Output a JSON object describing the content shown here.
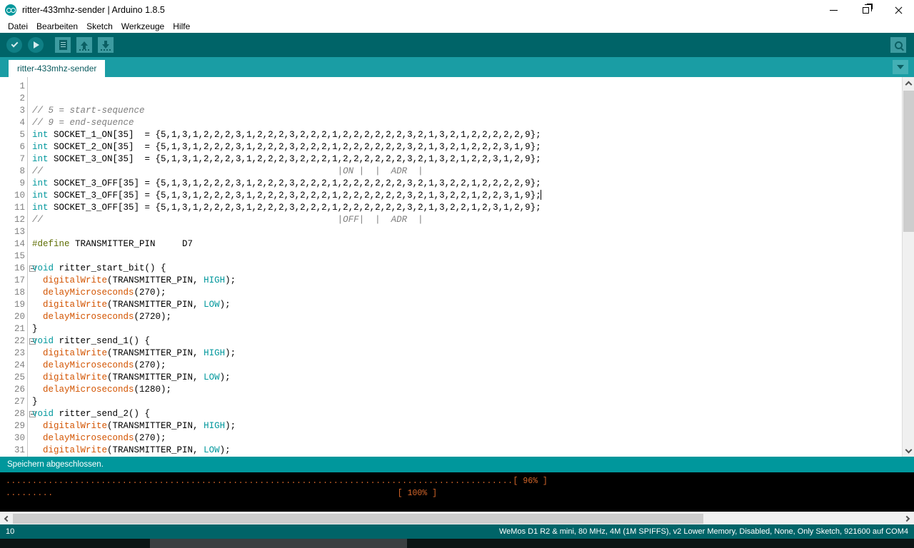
{
  "window": {
    "title": "ritter-433mhz-sender | Arduino 1.8.5",
    "app_icon": "arduino-infinity-icon",
    "controls": {
      "minimize": "minimize-icon",
      "maximize": "restore-icon",
      "close": "close-icon"
    }
  },
  "menu": {
    "items": [
      {
        "label": "Datei"
      },
      {
        "label": "Bearbeiten"
      },
      {
        "label": "Sketch"
      },
      {
        "label": "Werkzeuge"
      },
      {
        "label": "Hilfe"
      }
    ]
  },
  "toolbar": {
    "buttons": [
      {
        "name": "verify-button",
        "icon": "checkmark-icon"
      },
      {
        "name": "upload-button",
        "icon": "arrow-right-icon"
      },
      {
        "name": "new-button",
        "icon": "document-icon"
      },
      {
        "name": "open-button",
        "icon": "arrow-up-icon"
      },
      {
        "name": "save-button",
        "icon": "arrow-down-icon"
      }
    ],
    "serial_monitor": {
      "name": "serial-monitor-button",
      "icon": "magnifier-icon"
    }
  },
  "tabs": {
    "active": "ritter-433mhz-sender",
    "menu_icon": "chevron-down-icon"
  },
  "editor": {
    "cursor_line": 10,
    "lines": [
      {
        "n": 1,
        "fold": false,
        "tokens": []
      },
      {
        "n": 2,
        "fold": false,
        "tokens": []
      },
      {
        "n": 3,
        "fold": false,
        "tokens": [
          {
            "c": "c",
            "t": "// 5 = start-sequence"
          }
        ]
      },
      {
        "n": 4,
        "fold": false,
        "tokens": [
          {
            "c": "c",
            "t": "// 9 = end-sequence"
          }
        ]
      },
      {
        "n": 5,
        "fold": false,
        "tokens": [
          {
            "c": "k",
            "t": "int"
          },
          {
            "c": "t",
            "t": " SOCKET_1_ON[35]  = {5,1,3,1,2,2,2,3,1,2,2,2,3,2,2,2,1,2,2,2,2,2,2,3,2,1,3,2,1,2,2,2,2,2,9};"
          }
        ]
      },
      {
        "n": 6,
        "fold": false,
        "tokens": [
          {
            "c": "k",
            "t": "int"
          },
          {
            "c": "t",
            "t": " SOCKET_2_ON[35]  = {5,1,3,1,2,2,2,3,1,2,2,2,3,2,2,2,1,2,2,2,2,2,2,3,2,1,3,2,1,2,2,2,3,1,9};"
          }
        ]
      },
      {
        "n": 7,
        "fold": false,
        "tokens": [
          {
            "c": "k",
            "t": "int"
          },
          {
            "c": "t",
            "t": " SOCKET_3_ON[35]  = {5,1,3,1,2,2,2,3,1,2,2,2,3,2,2,2,1,2,2,2,2,2,2,3,2,1,3,2,1,2,2,3,1,2,9};"
          }
        ]
      },
      {
        "n": 8,
        "fold": false,
        "tokens": [
          {
            "c": "c",
            "t": "//                                                       |ON |  |  ADR  |"
          }
        ]
      },
      {
        "n": 9,
        "fold": false,
        "tokens": [
          {
            "c": "k",
            "t": "int"
          },
          {
            "c": "t",
            "t": " SOCKET_3_OFF[35] = {5,1,3,1,2,2,2,3,1,2,2,2,3,2,2,2,1,2,2,2,2,2,2,3,2,1,3,2,2,1,2,2,2,2,9};"
          }
        ]
      },
      {
        "n": 10,
        "fold": false,
        "cursor": true,
        "tokens": [
          {
            "c": "k",
            "t": "int"
          },
          {
            "c": "t",
            "t": " SOCKET_3_OFF[35] = {5,1,3,1,2,2,2,3,1,2,2,2,3,2,2,2,1,2,2,2,2,2,2,3,2,1,3,2,2,1,2,2,3,1,9};"
          }
        ]
      },
      {
        "n": 11,
        "fold": false,
        "tokens": [
          {
            "c": "k",
            "t": "int"
          },
          {
            "c": "t",
            "t": " SOCKET_3_OFF[35] = {5,1,3,1,2,2,2,3,1,2,2,2,3,2,2,2,1,2,2,2,2,2,2,3,2,1,3,2,2,1,2,3,1,2,9};"
          }
        ]
      },
      {
        "n": 12,
        "fold": false,
        "tokens": [
          {
            "c": "c",
            "t": "//                                                       |OFF|  |  ADR  |"
          }
        ]
      },
      {
        "n": 13,
        "fold": false,
        "tokens": []
      },
      {
        "n": 14,
        "fold": false,
        "tokens": [
          {
            "c": "pp",
            "t": "#define"
          },
          {
            "c": "t",
            "t": " TRANSMITTER_PIN     D7"
          }
        ]
      },
      {
        "n": 15,
        "fold": false,
        "tokens": []
      },
      {
        "n": 16,
        "fold": true,
        "tokens": [
          {
            "c": "k",
            "t": "void"
          },
          {
            "c": "t",
            "t": " ritter_start_bit() {"
          }
        ]
      },
      {
        "n": 17,
        "fold": false,
        "tokens": [
          {
            "c": "t",
            "t": "  "
          },
          {
            "c": "f",
            "t": "digitalWrite"
          },
          {
            "c": "t",
            "t": "(TRANSMITTER_PIN, "
          },
          {
            "c": "lit",
            "t": "HIGH"
          },
          {
            "c": "t",
            "t": ");"
          }
        ]
      },
      {
        "n": 18,
        "fold": false,
        "tokens": [
          {
            "c": "t",
            "t": "  "
          },
          {
            "c": "f",
            "t": "delayMicroseconds"
          },
          {
            "c": "t",
            "t": "(270);"
          }
        ]
      },
      {
        "n": 19,
        "fold": false,
        "tokens": [
          {
            "c": "t",
            "t": "  "
          },
          {
            "c": "f",
            "t": "digitalWrite"
          },
          {
            "c": "t",
            "t": "(TRANSMITTER_PIN, "
          },
          {
            "c": "lit",
            "t": "LOW"
          },
          {
            "c": "t",
            "t": ");"
          }
        ]
      },
      {
        "n": 20,
        "fold": false,
        "tokens": [
          {
            "c": "t",
            "t": "  "
          },
          {
            "c": "f",
            "t": "delayMicroseconds"
          },
          {
            "c": "t",
            "t": "(2720);"
          }
        ]
      },
      {
        "n": 21,
        "fold": false,
        "tokens": [
          {
            "c": "t",
            "t": "}"
          }
        ]
      },
      {
        "n": 22,
        "fold": true,
        "tokens": [
          {
            "c": "k",
            "t": "void"
          },
          {
            "c": "t",
            "t": " ritter_send_1() {"
          }
        ]
      },
      {
        "n": 23,
        "fold": false,
        "tokens": [
          {
            "c": "t",
            "t": "  "
          },
          {
            "c": "f",
            "t": "digitalWrite"
          },
          {
            "c": "t",
            "t": "(TRANSMITTER_PIN, "
          },
          {
            "c": "lit",
            "t": "HIGH"
          },
          {
            "c": "t",
            "t": ");"
          }
        ]
      },
      {
        "n": 24,
        "fold": false,
        "tokens": [
          {
            "c": "t",
            "t": "  "
          },
          {
            "c": "f",
            "t": "delayMicroseconds"
          },
          {
            "c": "t",
            "t": "(270);"
          }
        ]
      },
      {
        "n": 25,
        "fold": false,
        "tokens": [
          {
            "c": "t",
            "t": "  "
          },
          {
            "c": "f",
            "t": "digitalWrite"
          },
          {
            "c": "t",
            "t": "(TRANSMITTER_PIN, "
          },
          {
            "c": "lit",
            "t": "LOW"
          },
          {
            "c": "t",
            "t": ");"
          }
        ]
      },
      {
        "n": 26,
        "fold": false,
        "tokens": [
          {
            "c": "t",
            "t": "  "
          },
          {
            "c": "f",
            "t": "delayMicroseconds"
          },
          {
            "c": "t",
            "t": "(1280);"
          }
        ]
      },
      {
        "n": 27,
        "fold": false,
        "tokens": [
          {
            "c": "t",
            "t": "}"
          }
        ]
      },
      {
        "n": 28,
        "fold": true,
        "tokens": [
          {
            "c": "k",
            "t": "void"
          },
          {
            "c": "t",
            "t": " ritter_send_2() {"
          }
        ]
      },
      {
        "n": 29,
        "fold": false,
        "tokens": [
          {
            "c": "t",
            "t": "  "
          },
          {
            "c": "f",
            "t": "digitalWrite"
          },
          {
            "c": "t",
            "t": "(TRANSMITTER_PIN, "
          },
          {
            "c": "lit",
            "t": "HIGH"
          },
          {
            "c": "t",
            "t": ");"
          }
        ]
      },
      {
        "n": 30,
        "fold": false,
        "tokens": [
          {
            "c": "t",
            "t": "  "
          },
          {
            "c": "f",
            "t": "delayMicroseconds"
          },
          {
            "c": "t",
            "t": "(270);"
          }
        ]
      },
      {
        "n": 31,
        "fold": false,
        "tokens": [
          {
            "c": "t",
            "t": "  "
          },
          {
            "c": "f",
            "t": "digitalWrite"
          },
          {
            "c": "t",
            "t": "(TRANSMITTER_PIN, "
          },
          {
            "c": "lit",
            "t": "LOW"
          },
          {
            "c": "t",
            "t": ");"
          }
        ]
      }
    ]
  },
  "status_message": "Speichern abgeschlossen.",
  "console": {
    "lines": [
      {
        "dots": "................................................................................................",
        "percent": "[ 96% ]"
      },
      {
        "dots": ".........",
        "percent": "[ 100% ]"
      }
    ]
  },
  "statusbar": {
    "line_number": "10",
    "board_info": "WeMos D1 R2 & mini, 80 MHz, 4M (1M SPIFFS), v2 Lower Memory, Disabled, None, Only Sketch, 921600 auf COM4"
  },
  "scrollbars": {
    "vertical": {
      "up_icon": "chevron-up-icon",
      "down_icon": "chevron-down-icon"
    },
    "horizontal": {
      "left_icon": "chevron-left-icon",
      "right_icon": "chevron-right-icon"
    }
  },
  "colors": {
    "accent_teal": "#00979c",
    "dark_teal": "#006468",
    "tabbar_teal": "#1a9da4",
    "keyword": "#00979c",
    "function": "#d35400",
    "comment": "#7e7e7e",
    "preprocessor": "#5e6d03",
    "console_text": "#d4662a"
  }
}
